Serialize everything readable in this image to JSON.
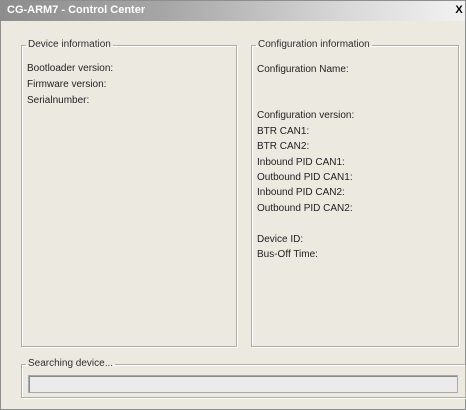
{
  "window": {
    "title": "CG-ARM7 - Control Center",
    "close_glyph": "X"
  },
  "device_info": {
    "legend": "Device information",
    "fields": [
      {
        "label": "Bootloader version:"
      },
      {
        "label": "Firmware version:"
      },
      {
        "label": "Serialnumber:"
      }
    ]
  },
  "config_info": {
    "legend": "Configuration information",
    "fields": [
      {
        "label": "Configuration Name:"
      },
      {
        "label": "Configuration version:"
      },
      {
        "label": "BTR CAN1:"
      },
      {
        "label": "BTR CAN2:"
      },
      {
        "label": "Inbound PID CAN1:"
      },
      {
        "label": "Outbound PID CAN1:"
      },
      {
        "label": "Inbound PID CAN2:"
      },
      {
        "label": "Outbound PID CAN2:"
      },
      {
        "label": "Device ID:"
      },
      {
        "label": "Bus-Off Time:"
      }
    ]
  },
  "search": {
    "legend": "Searching device...",
    "progress": 0
  },
  "colors": {
    "window_bg": "#ece9e1",
    "progress_fill": "#3c7ed3"
  }
}
